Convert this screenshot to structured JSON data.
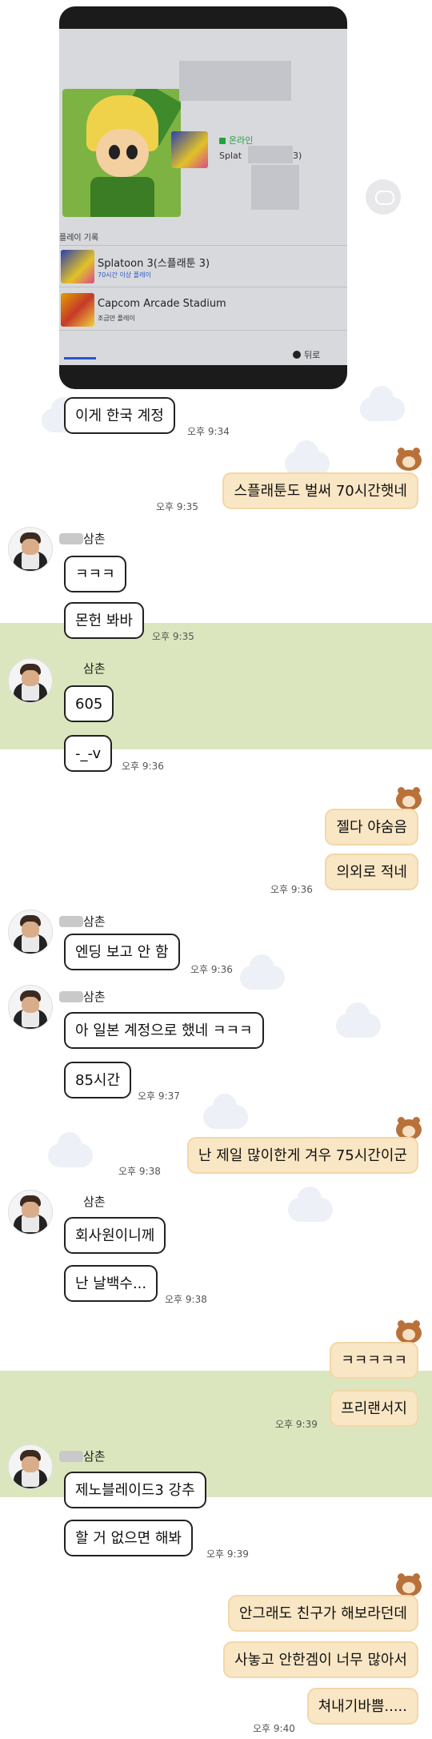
{
  "photo": {
    "status": "온라인",
    "game_partial": "Splat",
    "game_partial_tail": "3)",
    "history_header": "플레이 기록",
    "games": [
      {
        "title": "Splatoon 3(스플래툰 3)",
        "detail": "70시간 이상 플레이"
      },
      {
        "title": "Capcom Arcade Stadium",
        "detail": "조금만 플레이"
      }
    ],
    "back_label": "뒤로"
  },
  "contact_name": "삼촌",
  "messages": [
    {
      "text": "이게 한국 계정",
      "time": "오후 9:34"
    },
    {
      "text": "스플래툰도 벌써 70시간햇네",
      "time": "오후 9:35"
    },
    {
      "text": "ㅋㅋㅋ"
    },
    {
      "text": "몬헌 봐바",
      "time": "오후 9:35"
    },
    {
      "text": "605"
    },
    {
      "text": "-_-v",
      "time": "오후 9:36"
    },
    {
      "text": "젤다 야숨음"
    },
    {
      "text": "의외로 적네",
      "time": "오후 9:36"
    },
    {
      "text": "엔딩 보고 안 함",
      "time": "오후 9:36"
    },
    {
      "text": "아 일본 계정으로 했네 ㅋㅋㅋ"
    },
    {
      "text": "85시간",
      "time": "오후 9:37"
    },
    {
      "text": "난 제일 많이한게 겨우 75시간이군",
      "time": "오후 9:38"
    },
    {
      "text": "회사원이니께"
    },
    {
      "text": "난 날백수...",
      "time": "오후 9:38"
    },
    {
      "text": "ㅋㅋㅋㅋㅋ"
    },
    {
      "text": "프리랜서지",
      "time": "오후 9:39"
    },
    {
      "text": "제노블레이드3 강추"
    },
    {
      "text": "할 거 없으면 해봐",
      "time": "오후 9:39"
    },
    {
      "text": "안그래도 친구가 해보라던데"
    },
    {
      "text": "사놓고 안한겜이 너무 많아서"
    },
    {
      "text": "쳐내기바쁨.....",
      "time": "오후 9:40"
    }
  ]
}
